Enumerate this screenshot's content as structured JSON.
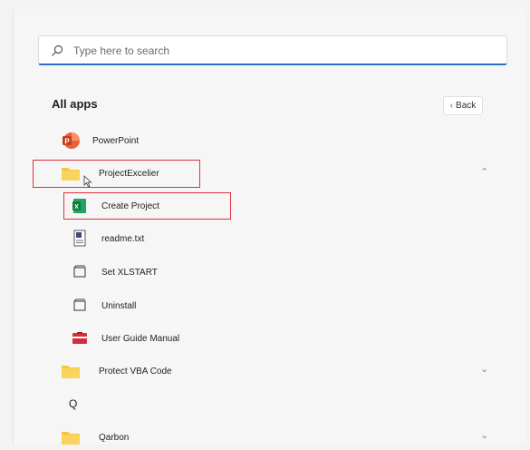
{
  "search": {
    "placeholder": "Type here to search"
  },
  "header": {
    "title": "All apps",
    "back_label": "Back"
  },
  "apps": [
    {
      "label": "PowerPoint",
      "icon": "powerpoint-icon"
    },
    {
      "label": "ProjectExcelier",
      "icon": "folder-icon",
      "expanded": true
    },
    {
      "label": "Create Project",
      "icon": "excel-icon"
    },
    {
      "label": "readme.txt",
      "icon": "text-file-icon"
    },
    {
      "label": "Set XLSTART",
      "icon": "shortcut-icon"
    },
    {
      "label": "Uninstall",
      "icon": "shortcut-icon"
    },
    {
      "label": "User Guide Manual",
      "icon": "pdf-icon"
    },
    {
      "label": "Protect VBA Code",
      "icon": "folder-icon",
      "expanded": false
    },
    {
      "label": "Qarbon",
      "icon": "folder-icon",
      "expanded": false
    }
  ],
  "section_letter": "Q",
  "colors": {
    "accent": "#2b6fc9",
    "highlight": "#e0313d",
    "folder": "#f5c542"
  }
}
